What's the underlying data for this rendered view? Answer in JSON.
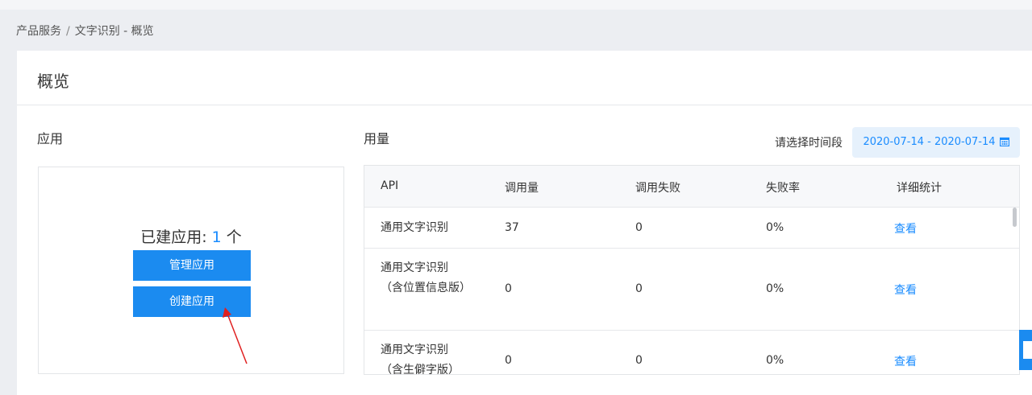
{
  "breadcrumb": {
    "parent": "产品服务",
    "separator": "/",
    "current": "文字识别 - 概览"
  },
  "page": {
    "title": "概览"
  },
  "apps": {
    "section_title": "应用",
    "count_prefix": "已建应用: ",
    "count": "1",
    "count_suffix": " 个",
    "manage_label": "管理应用",
    "create_label": "创建应用"
  },
  "usage": {
    "section_title": "用量",
    "date_label": "请选择时间段",
    "date_range": "2020-07-14 - 2020-07-14",
    "columns": [
      "API",
      "调用量",
      "调用失败",
      "失败率",
      "详细统计"
    ],
    "rows": [
      {
        "api": "通用文字识别",
        "calls": "37",
        "failures": "0",
        "rate": "0%",
        "action": "查看"
      },
      {
        "api": "通用文字识别（含位置信息版）",
        "calls": "0",
        "failures": "0",
        "rate": "0%",
        "action": "查看"
      },
      {
        "api": "通用文字识别（含生僻字版）",
        "calls": "0",
        "failures": "0",
        "rate": "0%",
        "action": "查看"
      }
    ]
  },
  "colors": {
    "accent": "#1b8bf0",
    "link": "#1a8cff",
    "annotation_arrow": "#e02020"
  },
  "icons": {
    "date_picker": "calendar-icon"
  }
}
